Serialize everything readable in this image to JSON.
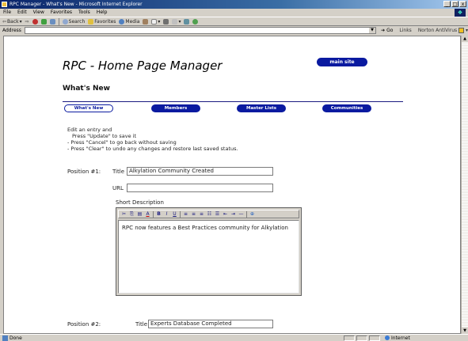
{
  "window": {
    "title": "RPC Manager - What's New - Microsoft Internet Explorer",
    "controls": [
      "_",
      "□",
      "x"
    ]
  },
  "menubar": {
    "items": [
      "File",
      "Edit",
      "View",
      "Favorites",
      "Tools",
      "Help"
    ]
  },
  "toolbar": {
    "back": "Back",
    "search": "Search",
    "favorites": "Favorites",
    "media": "Media"
  },
  "addressbar": {
    "label": "Address",
    "value": "",
    "go": "Go",
    "links": "Links",
    "norton": "Norton AntiVirus"
  },
  "page": {
    "title": "RPC - Home Page Manager",
    "main_site_button": "main site",
    "section_heading": "What's New",
    "nav_tabs": [
      {
        "label": "What's New",
        "active": true
      },
      {
        "label": "Members",
        "active": false
      },
      {
        "label": "Master Lists",
        "active": false
      },
      {
        "label": "Communities",
        "active": false
      }
    ],
    "instructions": [
      "Edit an entry and",
      "Press \"Update\" to save it",
      "- Press \"Cancel\" to go back without saving",
      "- Press \"Clear\" to undo any changes and restore last saved status."
    ]
  },
  "entries": [
    {
      "position_label": "Position #1:",
      "title_label": "Title",
      "title_value": "Alkylation Community Created",
      "url_label": "URL",
      "url_value": "",
      "description_label": "Short Description",
      "description_text": "RPC now features a Best Practices community for Alkylation"
    },
    {
      "position_label": "Position #2:",
      "title_label": "Title",
      "title_value": "Experts Database Completed"
    }
  ],
  "editor_toolbar": {
    "buttons": [
      "cut",
      "copy",
      "paste",
      "font-color",
      "bold",
      "italic",
      "underline",
      "align-left",
      "align-center",
      "align-right",
      "ordered-list",
      "unordered-list",
      "outdent",
      "indent",
      "horizontal-rule",
      "insert-link"
    ],
    "glyphs": {
      "cut": "✂",
      "copy": "⎘",
      "paste": "▤",
      "font-color": "A",
      "bold": "B",
      "italic": "I",
      "underline": "U",
      "align-left": "≡",
      "align-center": "≡",
      "align-right": "≡",
      "ordered-list": "☷",
      "unordered-list": "☰",
      "outdent": "⇤",
      "indent": "⇥",
      "horizontal-rule": "—",
      "insert-link": "⊕"
    }
  },
  "statusbar": {
    "text": "Done",
    "zone": "Internet"
  }
}
